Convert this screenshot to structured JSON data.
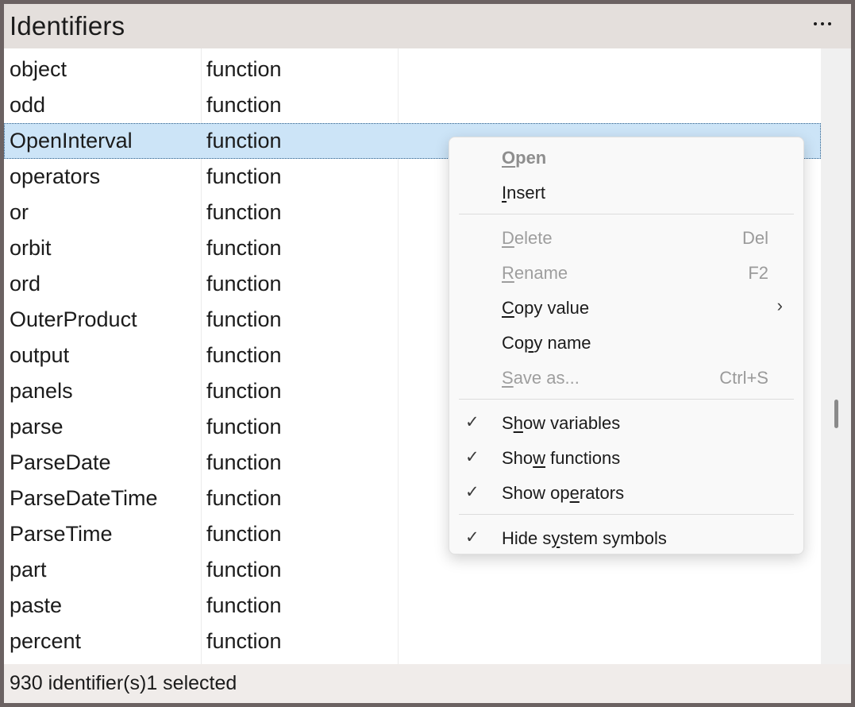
{
  "window": {
    "title": "Identifiers"
  },
  "title_bar": {
    "more_icon": "more-horizontal-icon"
  },
  "rows": [
    {
      "name": "object",
      "kind": "function"
    },
    {
      "name": "odd",
      "kind": "function"
    },
    {
      "name": "OpenInterval",
      "kind": "function",
      "selected": true
    },
    {
      "name": "operators",
      "kind": "function"
    },
    {
      "name": "or",
      "kind": "function"
    },
    {
      "name": "orbit",
      "kind": "function"
    },
    {
      "name": "ord",
      "kind": "function"
    },
    {
      "name": "OuterProduct",
      "kind": "function"
    },
    {
      "name": "output",
      "kind": "function"
    },
    {
      "name": "panels",
      "kind": "function"
    },
    {
      "name": "parse",
      "kind": "function"
    },
    {
      "name": "ParseDate",
      "kind": "function"
    },
    {
      "name": "ParseDateTime",
      "kind": "function"
    },
    {
      "name": "ParseTime",
      "kind": "function"
    },
    {
      "name": "part",
      "kind": "function"
    },
    {
      "name": "paste",
      "kind": "function"
    },
    {
      "name": "percent",
      "kind": "function"
    }
  ],
  "status": {
    "count": "930 identifier(s)",
    "selected": "1 selected"
  },
  "context_menu": {
    "open": {
      "before": "",
      "u": "O",
      "after": "pen"
    },
    "insert": {
      "before": "",
      "u": "I",
      "after": "nsert"
    },
    "delete": {
      "before": "",
      "u": "D",
      "after": "elete",
      "key": "Del"
    },
    "rename": {
      "before": "",
      "u": "R",
      "after": "ename",
      "key": "F2"
    },
    "copy_value": {
      "before": "",
      "u": "C",
      "after": "opy value",
      "submenu_icon": "chevron-right-icon"
    },
    "copy_name": {
      "before": "Co",
      "u": "p",
      "after": "y name"
    },
    "save_as": {
      "before": "",
      "u": "S",
      "after": "ave as...",
      "key": "Ctrl+S"
    },
    "show_variables": {
      "before": "S",
      "u": "h",
      "after": "ow variables",
      "checked": true
    },
    "show_functions": {
      "before": "Sho",
      "u": "w",
      "after": " functions",
      "checked": true
    },
    "show_operators": {
      "before": "Show op",
      "u": "e",
      "after": "rators",
      "checked": true
    },
    "hide_system_symbols": {
      "before": "Hide s",
      "u": "y",
      "after": "stem symbols",
      "checked": true
    },
    "check_glyph": "✓",
    "chevron_glyph": "›"
  },
  "colors": {
    "selection": "#cce4f7",
    "titlebar": "#e4dfdc",
    "disabled_text": "#9e9e9e"
  }
}
